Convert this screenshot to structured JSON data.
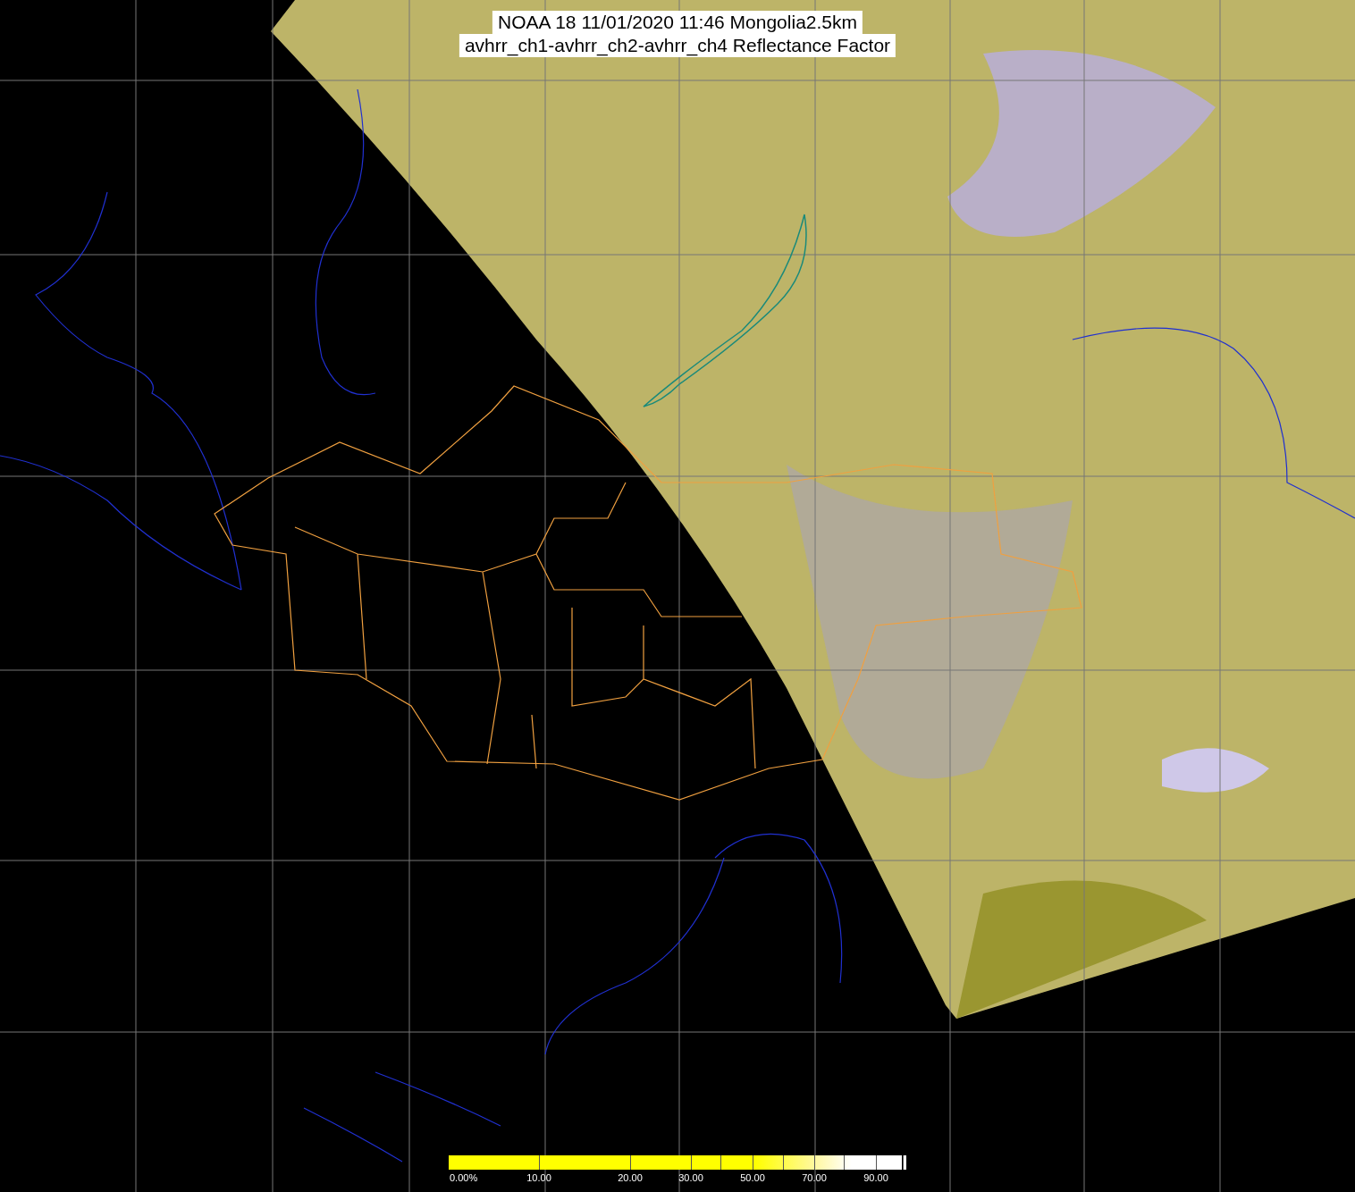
{
  "title": {
    "lines": [
      "NOAA 18 11/01/2020 11:46 Mongolia2.5km",
      "avhrr_ch1-avhrr_ch2-avhrr_ch4 Reflectance Factor"
    ]
  },
  "legend": {
    "labels": [
      "0.00%",
      "10.00",
      "20.00",
      "30.00",
      "50.00",
      "70.00",
      "90.00"
    ]
  }
}
